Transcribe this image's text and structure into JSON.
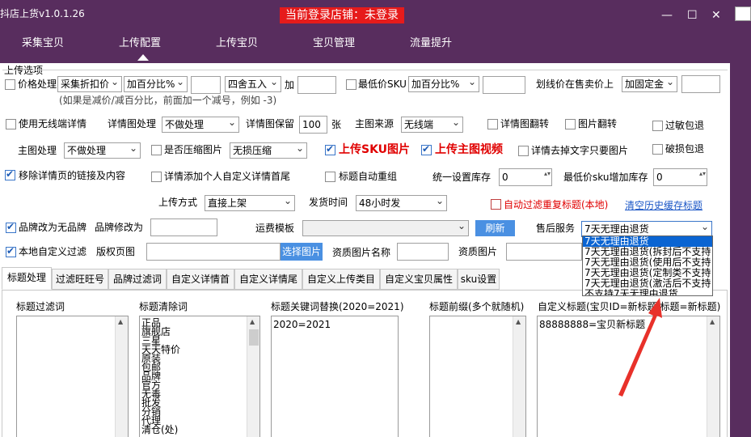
{
  "app": {
    "title": "抖店上货v1.0.1.26",
    "login_status": "当前登录店铺：未登录",
    "window_controls": {
      "minimize": "—",
      "maximize": "☐",
      "close": "✕"
    }
  },
  "nav": {
    "tabs": [
      {
        "label": "采集宝贝"
      },
      {
        "label": "上传配置"
      },
      {
        "label": "上传宝贝"
      },
      {
        "label": "宝贝管理"
      },
      {
        "label": "流量提升"
      }
    ],
    "active": "上传配置"
  },
  "upload_options": {
    "section_label": "上传选项",
    "price": {
      "label": "价格处理",
      "source_value": "采集折扣价",
      "mode_value": "加百分比%",
      "amount_value": "",
      "rounding_value": "四舍五入",
      "add_label": "加",
      "add_value": "",
      "hint": "(如果是减价/减百分比，前面加一个减号，例如 -3)"
    },
    "min_sku": {
      "label": "最低价SKU",
      "mode_value": "加百分比%",
      "value": ""
    },
    "strike_price": {
      "label": "划线价在售卖价上",
      "mode_value": "加固定金",
      "value": ""
    },
    "wireless_detail_label": "使用无线端详情",
    "detail_image": {
      "label": "详情图处理",
      "value": "不做处理"
    },
    "detail_keep": {
      "label": "详情图保留",
      "value": "100",
      "unit": "张"
    },
    "main_image_source": {
      "label": "主图来源",
      "value": "无线端"
    },
    "detail_flip_label": "详情图翻转",
    "image_flip_label": "图片翻转",
    "sensitive_pack_label": "过敏包退",
    "main_image": {
      "label": "主图处理",
      "value": "不做处理"
    },
    "compress": {
      "label": "是否压缩图片",
      "value": "无损压缩"
    },
    "upload_sku_image_label": "上传SKU图片",
    "upload_main_video_label": "上传主图视频",
    "detail_remove_text_label": "详情去掉文字只要图片",
    "broken_pack_label": "破损包退",
    "remove_links_label": "移除详情页的链接及内容",
    "add_custom_detail_label": "详情添加个人自定义详情首尾",
    "auto_regroup_title_label": "标题自动重组",
    "unified_stock": {
      "label": "统一设置库存",
      "value": "0"
    },
    "min_sku_stock": {
      "label": "最低价sku增加库存",
      "value": "0"
    },
    "upload_method": {
      "label": "上传方式",
      "value": "直接上架"
    },
    "ship_time": {
      "label": "发货时间",
      "value": "48小时发"
    },
    "auto_filter_dup_label": "自动过滤重复标题(本地)",
    "clear_cache_link": "清空历史缓存标题",
    "brand_to_none": {
      "label": "品牌改为无品牌",
      "modify_label": "品牌修改为",
      "value": ""
    },
    "shipping_template": {
      "label": "运费模板",
      "value": "",
      "refresh_label": "刷新"
    },
    "after_sale": {
      "label": "售后服务",
      "value": "7天无理由退货",
      "options": [
        "7天无理由退货",
        "7天无理由退货(拆封后不支持",
        "7天无理由退货(使用后不支持",
        "7天无理由退货(定制类不支持",
        "7天无理由退货(激活后不支持",
        "不支持7天无理由退货"
      ]
    },
    "local_filter_label": "本地自定义过滤",
    "copyright_page": {
      "label": "版权页图",
      "value": "",
      "button_label": "选择图片"
    },
    "qualification_name": {
      "label": "资质图片名称",
      "value": ""
    },
    "qualification_image": {
      "label": "资质图片",
      "value": ""
    }
  },
  "subtabs": [
    {
      "label": "标题处理"
    },
    {
      "label": "过滤旺旺号"
    },
    {
      "label": "品牌过滤词"
    },
    {
      "label": "自定义详情首"
    },
    {
      "label": "自定义详情尾"
    },
    {
      "label": "自定义上传类目"
    },
    {
      "label": "自定义宝贝属性"
    },
    {
      "label": "sku设置"
    }
  ],
  "title_panel": {
    "filter_words": {
      "title": "标题过滤词",
      "lines": []
    },
    "clear_words": {
      "title": "标题清除词",
      "lines": [
        "正品",
        "旗舰店",
        "三星",
        "天天特价",
        "原装",
        "包邮",
        "品牌",
        "官方",
        "无毒",
        "批发",
        "分销",
        "代理",
        "清仓(处)"
      ]
    },
    "keyword_replace": {
      "title": "标题关键词替换(2020=2021)",
      "lines": [
        "2020=2021"
      ]
    },
    "prefix": {
      "title": "标题前缀(多个就随机)",
      "lines": []
    },
    "custom_title": {
      "title": "自定义标题(宝贝ID=新标题/标题=新标题)",
      "lines": [
        "88888888=宝贝新标题"
      ]
    }
  },
  "colors": {
    "header_bg": "#582d5e",
    "login_bg": "#e61b1b",
    "highlight_red": "#e00000",
    "link_blue": "#1a56c6",
    "select_blue": "#0a64d2",
    "arrow_red": "#e8312a"
  }
}
